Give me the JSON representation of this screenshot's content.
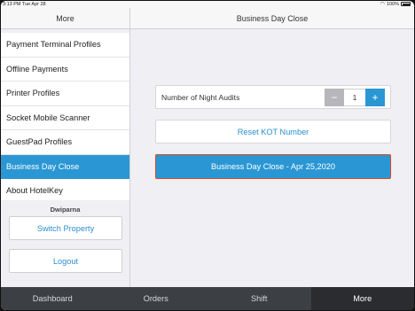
{
  "status_bar": {
    "time": "3:13 PM  Tue Apr 28",
    "battery": "100%",
    "battery_icon": "battery-icon",
    "wifi_icon": "wifi-icon"
  },
  "sidebar": {
    "title": "More",
    "items": [
      {
        "label": "Payment Terminal Profiles"
      },
      {
        "label": "Offline Payments"
      },
      {
        "label": "Printer Profiles"
      },
      {
        "label": "Socket Mobile Scanner"
      },
      {
        "label": "GuestPad Profiles"
      },
      {
        "label": "Business Day Close",
        "active": true
      },
      {
        "label": "About HotelKey"
      }
    ],
    "username": "Dwiparna",
    "switch_label": "Switch Property",
    "logout_label": "Logout"
  },
  "main": {
    "title": "Business Day Close",
    "night_audits_label": "Number of Night Audits",
    "night_audits_value": "1",
    "minus_label": "−",
    "plus_label": "+",
    "reset_label": "Reset KOT Number",
    "close_label": "Business Day Close - Apr 25,2020"
  },
  "tabs": [
    {
      "label": "Dashboard"
    },
    {
      "label": "Orders"
    },
    {
      "label": "Shift"
    },
    {
      "label": "More",
      "active": true
    }
  ],
  "colors": {
    "accent": "#2a97d4",
    "highlight_border": "#e0481e",
    "tabbar": "#3c3f44"
  }
}
